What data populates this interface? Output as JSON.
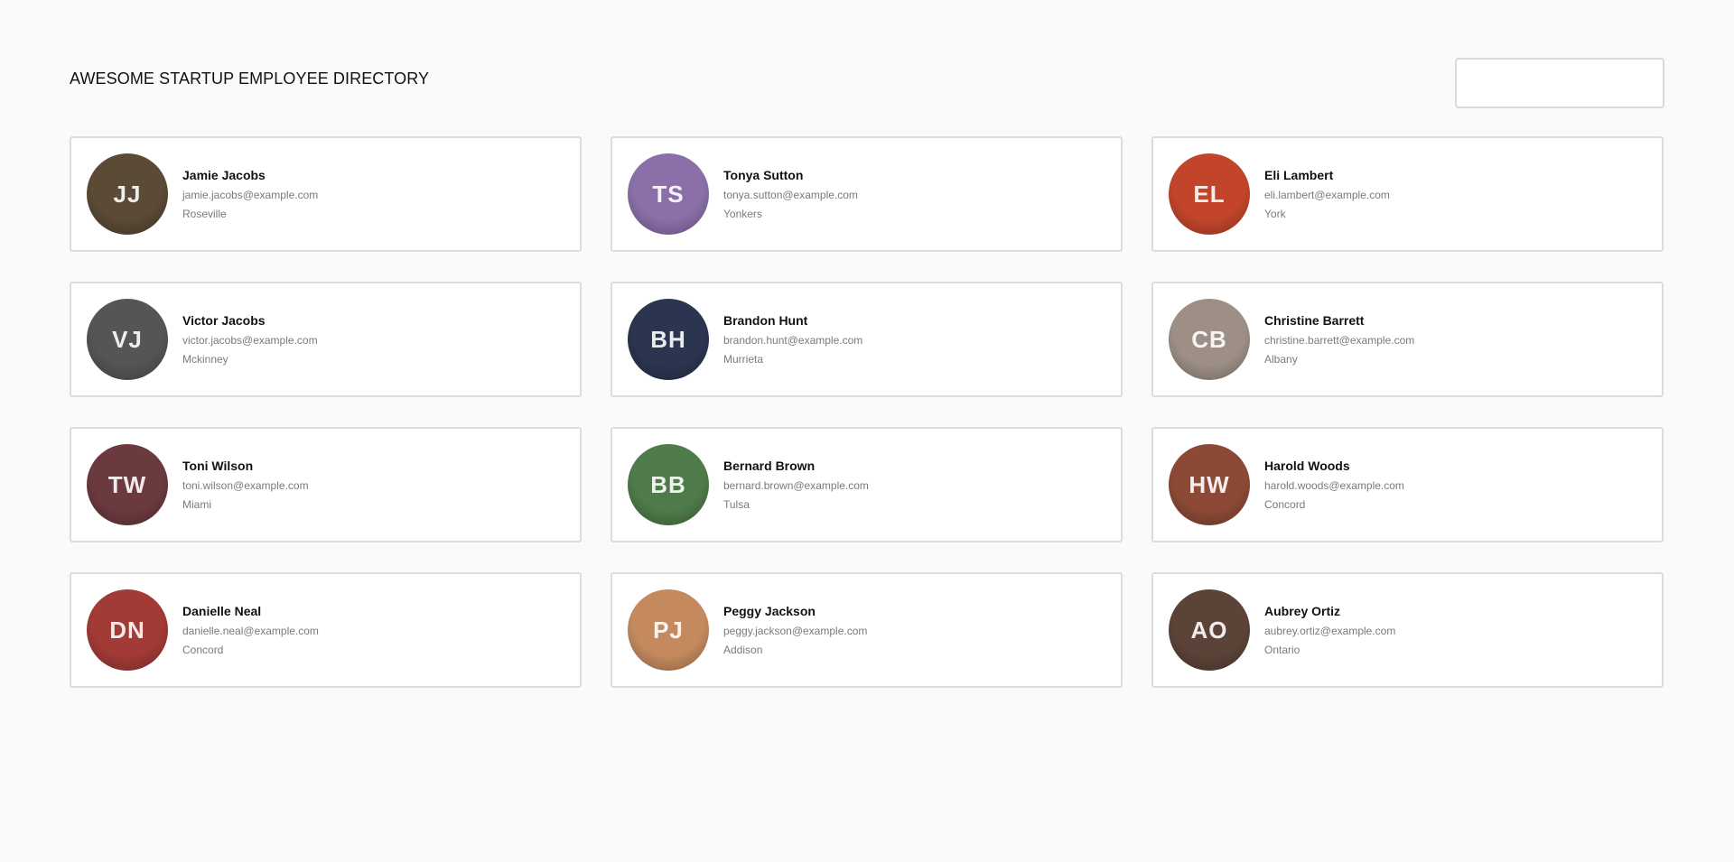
{
  "header": {
    "title": "AWESOME STARTUP EMPLOYEE DIRECTORY",
    "search": {
      "value": "",
      "placeholder": ""
    }
  },
  "employees": [
    {
      "name": "Jamie Jacobs",
      "email": "jamie.jacobs@example.com",
      "city": "Roseville",
      "initials": "JJ",
      "avatar_color": "#5a4a36"
    },
    {
      "name": "Tonya Sutton",
      "email": "tonya.sutton@example.com",
      "city": "Yonkers",
      "initials": "TS",
      "avatar_color": "#8a6fa8"
    },
    {
      "name": "Eli Lambert",
      "email": "eli.lambert@example.com",
      "city": "York",
      "initials": "EL",
      "avatar_color": "#c2452b"
    },
    {
      "name": "Victor Jacobs",
      "email": "victor.jacobs@example.com",
      "city": "Mckinney",
      "initials": "VJ",
      "avatar_color": "#555555"
    },
    {
      "name": "Brandon Hunt",
      "email": "brandon.hunt@example.com",
      "city": "Murrieta",
      "initials": "BH",
      "avatar_color": "#2b3550"
    },
    {
      "name": "Christine Barrett",
      "email": "christine.barrett@example.com",
      "city": "Albany",
      "initials": "CB",
      "avatar_color": "#9d8f86"
    },
    {
      "name": "Toni Wilson",
      "email": "toni.wilson@example.com",
      "city": "Miami",
      "initials": "TW",
      "avatar_color": "#6b3a3f"
    },
    {
      "name": "Bernard Brown",
      "email": "bernard.brown@example.com",
      "city": "Tulsa",
      "initials": "BB",
      "avatar_color": "#4f7a4a"
    },
    {
      "name": "Harold Woods",
      "email": "harold.woods@example.com",
      "city": "Concord",
      "initials": "HW",
      "avatar_color": "#8c4a36"
    },
    {
      "name": "Danielle Neal",
      "email": "danielle.neal@example.com",
      "city": "Concord",
      "initials": "DN",
      "avatar_color": "#a23a36"
    },
    {
      "name": "Peggy Jackson",
      "email": "peggy.jackson@example.com",
      "city": "Addison",
      "initials": "PJ",
      "avatar_color": "#c48a5e"
    },
    {
      "name": "Aubrey Ortiz",
      "email": "aubrey.ortiz@example.com",
      "city": "Ontario",
      "initials": "AO",
      "avatar_color": "#5c4338"
    }
  ]
}
